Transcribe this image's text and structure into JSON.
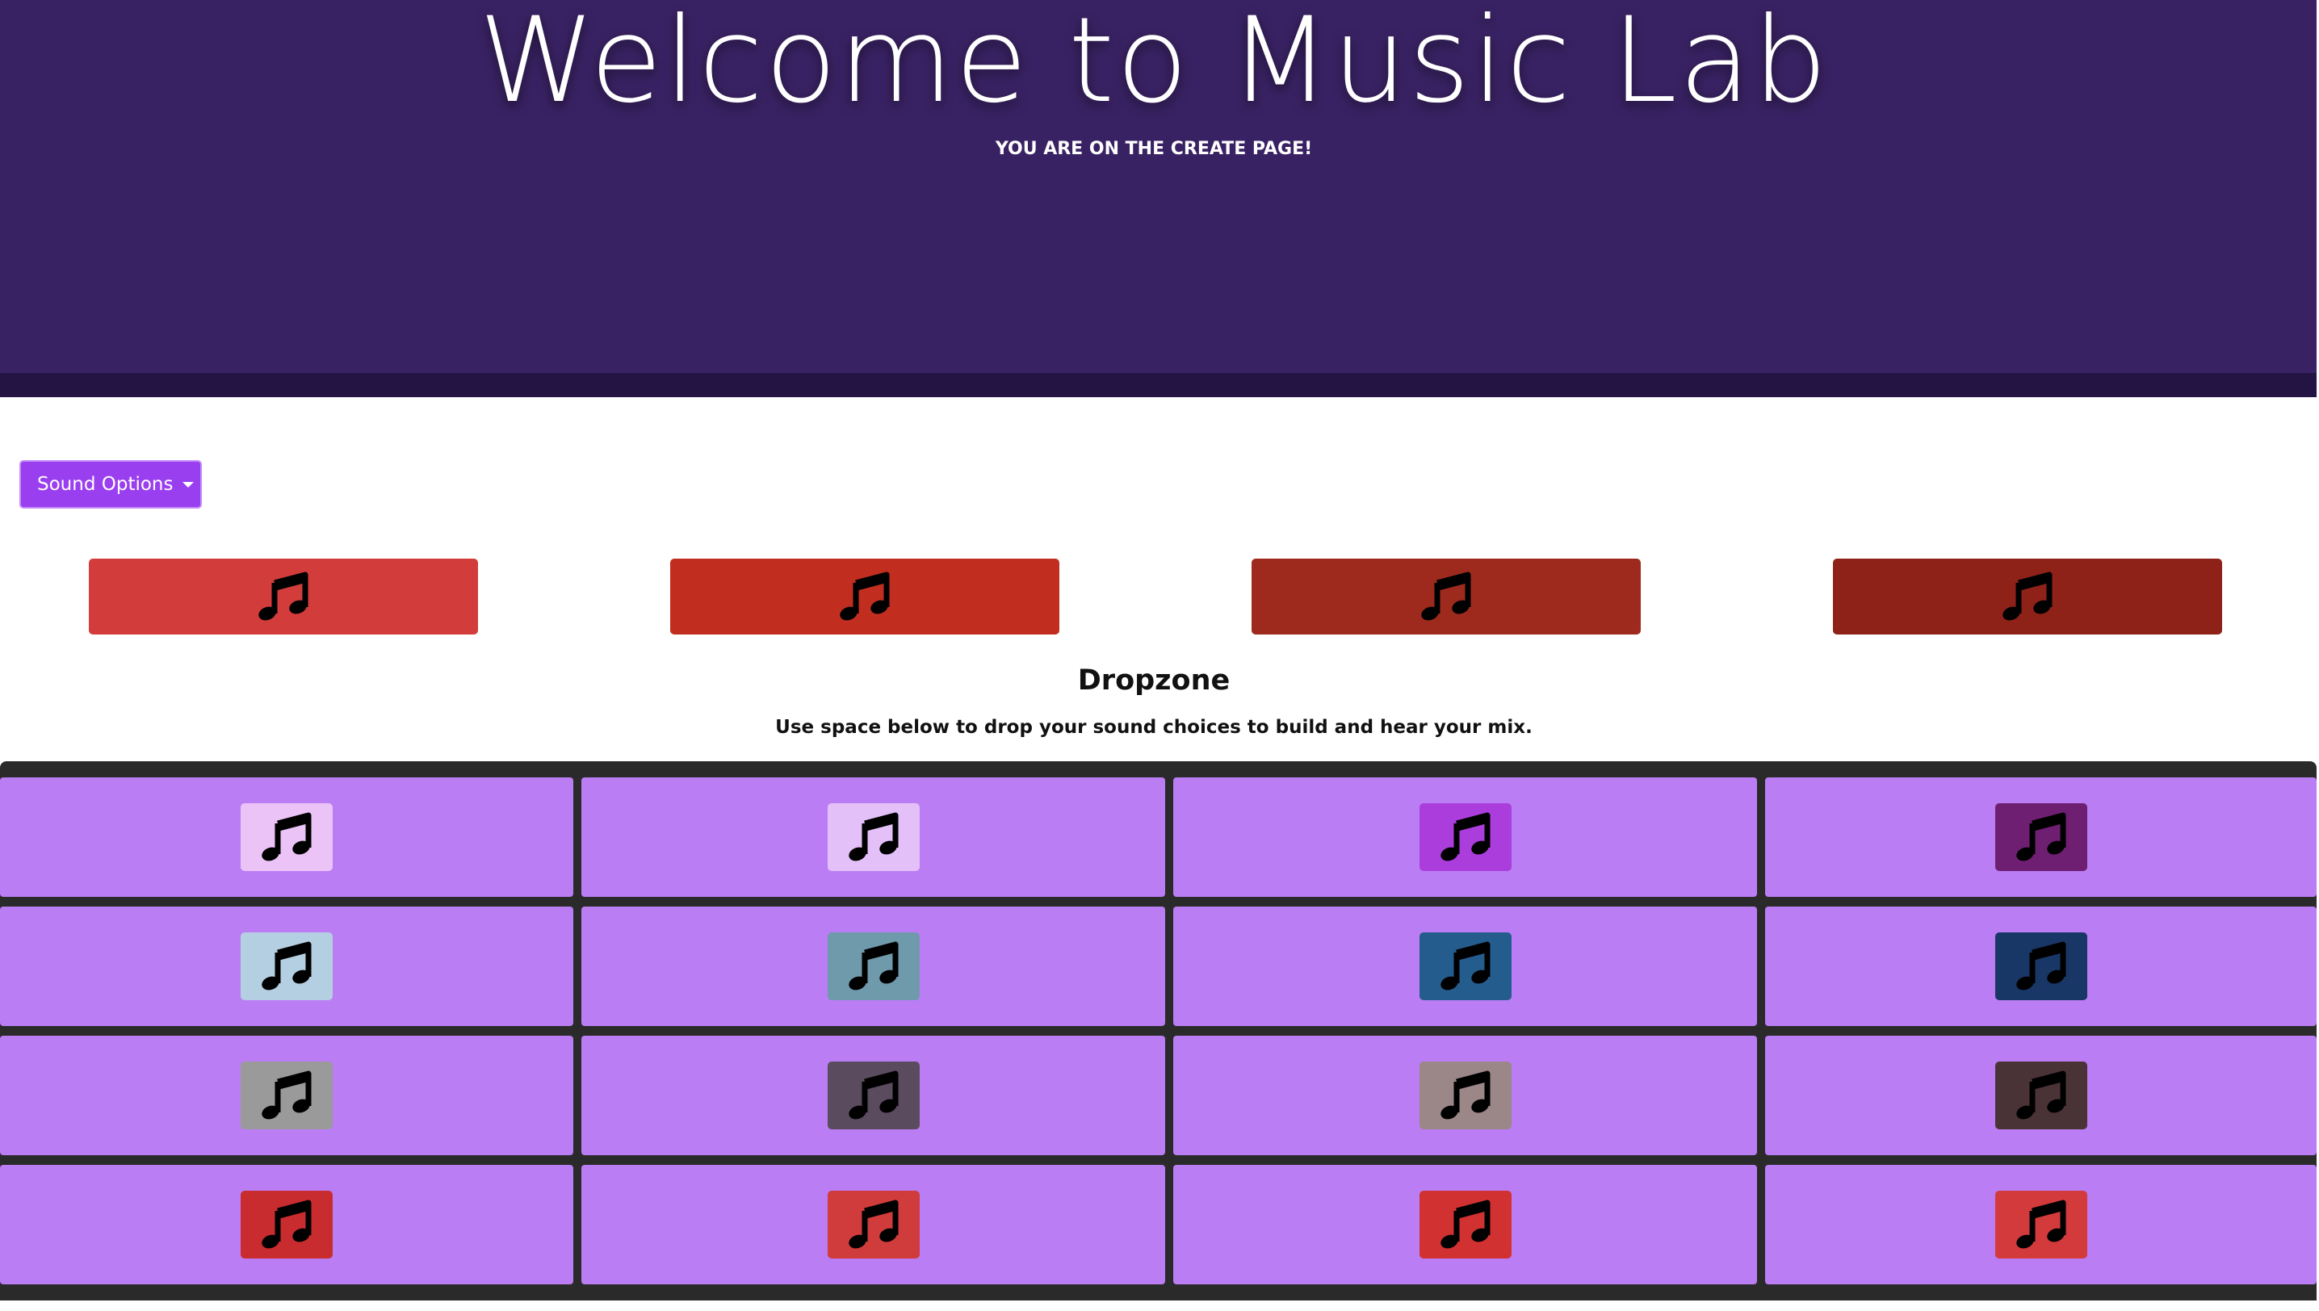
{
  "header": {
    "title": "Welcome to Music Lab",
    "subtitle": "YOU ARE ON THE CREATE PAGE!"
  },
  "sound_options": {
    "label": "Sound Options"
  },
  "top_sounds": [
    {
      "icon": "music-note-icon",
      "color": "#d23c3a"
    },
    {
      "icon": "music-note-icon",
      "color": "#c12e1f"
    },
    {
      "icon": "music-note-icon",
      "color": "#9e2a1e"
    },
    {
      "icon": "music-note-icon",
      "color": "#8e2218"
    }
  ],
  "dropzone": {
    "title": "Dropzone",
    "instructions": "Use space below to drop your sound choices to build and hear your mix."
  },
  "grid": {
    "cell_color": "#bb7df4",
    "rows": [
      [
        "#ebc3f7",
        "#e4c0f8",
        "#ab3ddc",
        "#6f1f72"
      ],
      [
        "#b5cfe2",
        "#6f9aab",
        "#245c8e",
        "#193766"
      ],
      [
        "#9a9a9a",
        "#5a4c5e",
        "#9c8788",
        "#4a3337"
      ],
      [
        "#c92c2e",
        "#d03b3b",
        "#d23131",
        "#d33a3c"
      ]
    ]
  },
  "colors": {
    "hero": "#392263",
    "hero_band": "#231444",
    "dropdown": "#9a3ff0",
    "grid_bg": "#2b2a2b"
  }
}
